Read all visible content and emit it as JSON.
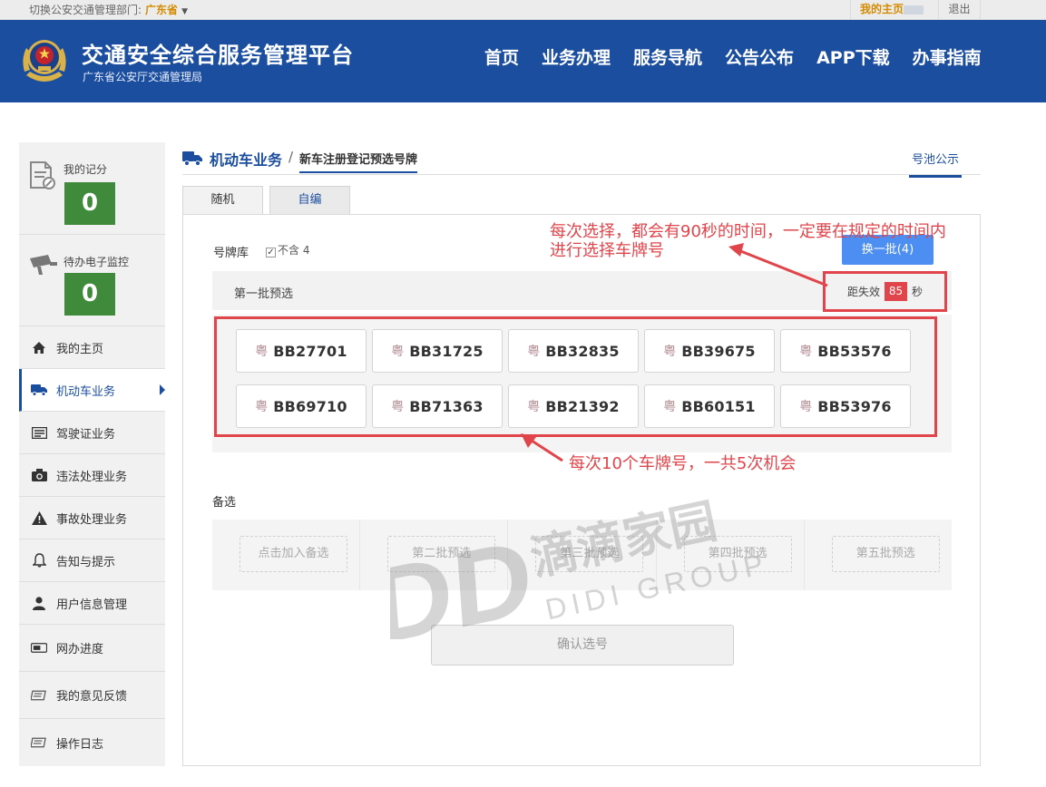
{
  "topbar": {
    "switch_label": "切换公安交通管理部门:",
    "province": "广东省",
    "home_label": "我的主页",
    "logout_label": "退出"
  },
  "header": {
    "title": "交通安全综合服务管理平台",
    "subtitle": "广东省公安厅交通管理局",
    "nav": [
      "首页",
      "业务办理",
      "服务导航",
      "公告公布",
      "APP下载",
      "办事指南"
    ]
  },
  "sidebar": {
    "score_label": "我的记分",
    "score_value": "0",
    "monitor_label": "待办电子监控",
    "monitor_value": "0",
    "items": [
      {
        "label": "我的主页",
        "icon": "home-icon"
      },
      {
        "label": "机动车业务",
        "icon": "truck-icon",
        "active": true
      },
      {
        "label": "驾驶证业务",
        "icon": "license-card-icon"
      },
      {
        "label": "违法处理业务",
        "icon": "camera-icon"
      },
      {
        "label": "事故处理业务",
        "icon": "warning-icon"
      },
      {
        "label": "告知与提示",
        "icon": "bell-icon"
      },
      {
        "label": "用户信息管理",
        "icon": "user-icon"
      },
      {
        "label": "网办进度",
        "icon": "progress-icon"
      },
      {
        "label": "我的意见反馈",
        "icon": "feedback-icon"
      },
      {
        "label": "操作日志",
        "icon": "log-icon"
      }
    ]
  },
  "breadcrumb": {
    "main": "机动车业务",
    "separator": "/",
    "sub": "新车注册登记预选号牌",
    "pool_link": "号池公示"
  },
  "tabs": [
    "随机",
    "自编"
  ],
  "panel": {
    "lib_label": "号牌库",
    "exclude_label": "不含 4",
    "refresh_label": "换一批(4)",
    "batch_title": "第一批预选",
    "expire_prefix": "距失效",
    "expire_seconds": "85",
    "expire_unit": "秒",
    "plate_province": "粤",
    "plates": [
      "BB27701",
      "BB31725",
      "BB32835",
      "BB39675",
      "BB53576",
      "BB69710",
      "BB71363",
      "BB21392",
      "BB60151",
      "BB53976"
    ],
    "alt_label": "备选",
    "alt_slots": [
      "点击加入备选",
      "第二批预选",
      "第三批预选",
      "第四批预选",
      "第五批预选"
    ],
    "confirm_label": "确认选号"
  },
  "annotations": {
    "note_top_line1": "每次选择，都会有90秒的时间，一定要在规定的时间内",
    "note_top_line2": "进行选择车牌号",
    "note_bottom": "每次10个车牌号，一共5次机会"
  },
  "watermark": {
    "cn": "滴滴家园",
    "en": "DIDI GROUP",
    "mark": "DD"
  },
  "colors": {
    "brand_blue": "#1c4e9f",
    "accent_orange": "#d38b00",
    "score_green": "#3f8a3b",
    "alert_red": "#e0454b",
    "button_blue": "#4c8ef2"
  }
}
